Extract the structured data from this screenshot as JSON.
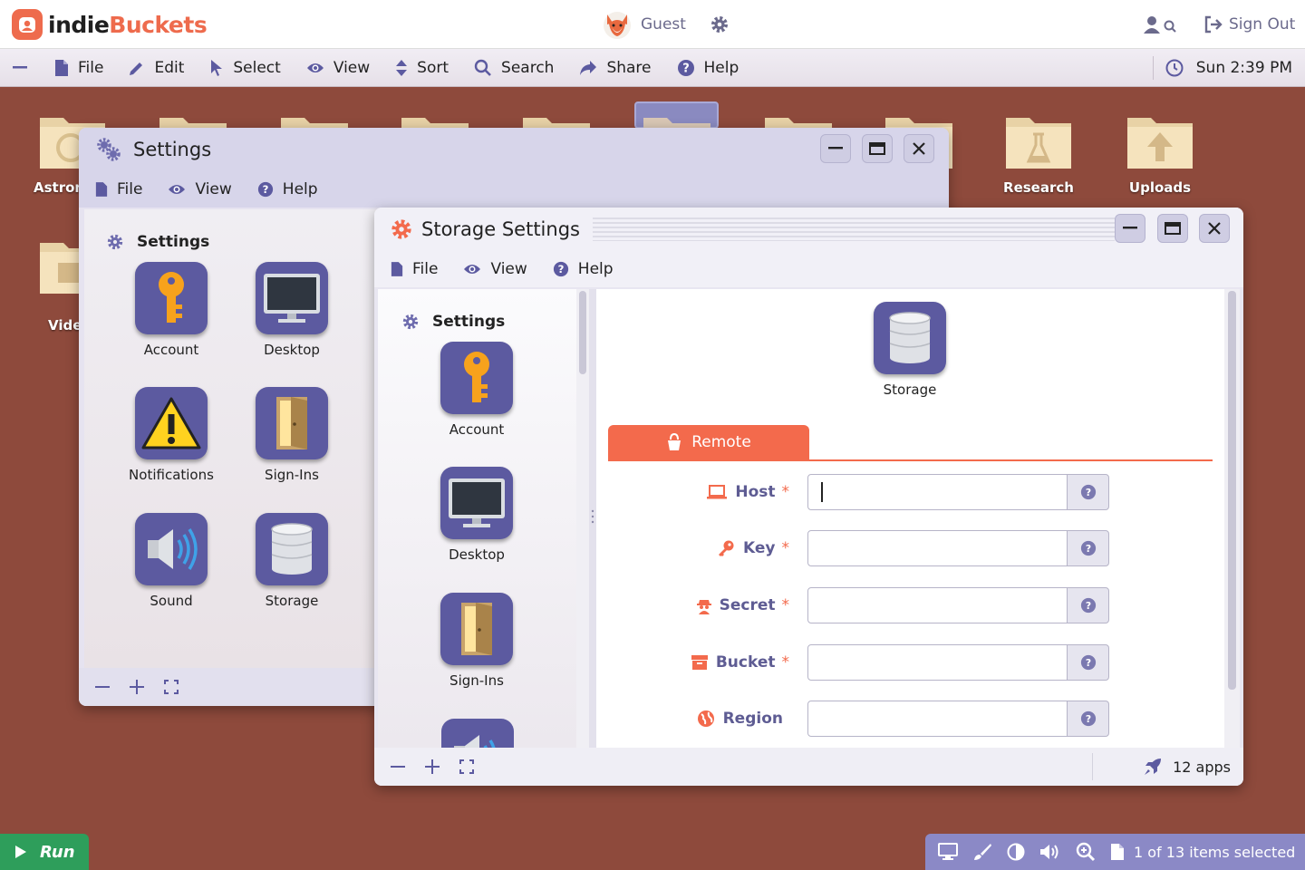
{
  "brand": {
    "word1": "indie",
    "word2": "Buckets"
  },
  "user": {
    "name": "Guest",
    "signout_label": "Sign Out"
  },
  "menubar": {
    "items": [
      {
        "label": "File",
        "icon": "file-icon"
      },
      {
        "label": "Edit",
        "icon": "pencil-icon"
      },
      {
        "label": "Select",
        "icon": "cursor-icon"
      },
      {
        "label": "View",
        "icon": "eye-icon"
      },
      {
        "label": "Sort",
        "icon": "sort-icon"
      },
      {
        "label": "Search",
        "icon": "search-icon"
      },
      {
        "label": "Share",
        "icon": "share-icon"
      },
      {
        "label": "Help",
        "icon": "help-icon"
      }
    ],
    "clock": "Sun 2:39 PM"
  },
  "desktop": {
    "icons": [
      {
        "label": "Astron"
      },
      {
        "label": "Vide"
      },
      {
        "label": "Research"
      },
      {
        "label": "Uploads"
      }
    ]
  },
  "settings_window": {
    "title": "Settings",
    "menu": [
      "File",
      "View",
      "Help"
    ],
    "section": "Settings",
    "apps": [
      "Account",
      "Desktop",
      "Notifications",
      "Sign-Ins",
      "Sound",
      "Storage"
    ]
  },
  "storage_window": {
    "title": "Storage Settings",
    "menu": [
      "File",
      "View",
      "Help"
    ],
    "section": "Settings",
    "apps": [
      "Account",
      "Desktop",
      "Sign-Ins"
    ],
    "header_app": "Storage",
    "tab": "Remote",
    "fields": [
      {
        "label": "Host",
        "required": "*",
        "value": "",
        "icon": "laptop-icon"
      },
      {
        "label": "Key",
        "required": "*",
        "value": "",
        "icon": "key-icon"
      },
      {
        "label": "Secret",
        "required": "*",
        "value": "",
        "icon": "spy-icon"
      },
      {
        "label": "Bucket",
        "required": "*",
        "value": "",
        "icon": "archive-icon"
      },
      {
        "label": "Region",
        "required": "",
        "value": "",
        "icon": "globe-icon"
      }
    ],
    "app_count": "12 apps"
  },
  "taskbar": {
    "run_label": "Run",
    "selection": "1 of 13 items selected"
  },
  "colors": {
    "accent": "#f36a4c",
    "primary": "#5c5aa0",
    "desktop": "#8e4a3c",
    "run": "#2e9e5b",
    "tray": "#8b89c6"
  }
}
